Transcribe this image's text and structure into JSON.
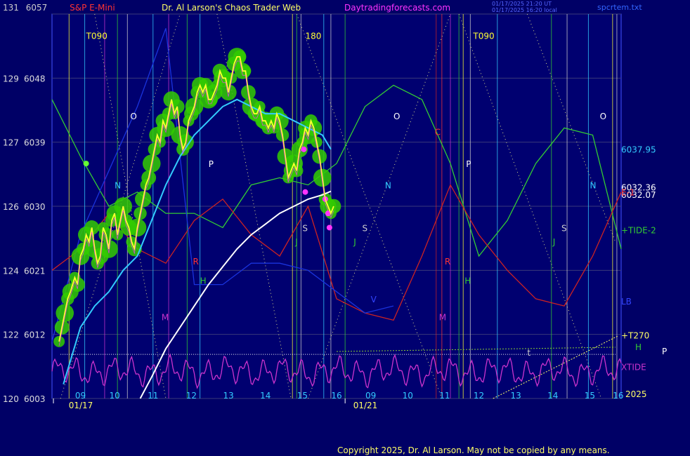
{
  "header": {
    "instrument": "S&P E-Mini",
    "author": "Dr. Al Larson's Chaos Trader Web",
    "site": "Daytradingforecasts.com",
    "stamp1": "01/17/2025 21:20 UT",
    "stamp2": "01/17/2025 16:20 local",
    "file": "spcrtem.txt"
  },
  "copyright": "Copyright 2025, Dr. Al Larson. May not be copied by any means.",
  "colors": {
    "background": "#000066",
    "grid": "#3a3a7a",
    "price": "#ffff33",
    "ma_fast": "#33ccff",
    "ma_slow": "#ffffff",
    "tide2": "#33cc33",
    "red_line": "#cc2222",
    "blue_line": "#1a33dd",
    "xtide": "#cc33cc",
    "blob": "#33cc00",
    "magenta_dot": "#ff33ff"
  },
  "chart_data": {
    "type": "line",
    "title": "S&P E-Mini",
    "y_axis": {
      "ylim": [
        6003,
        6057
      ],
      "tick_labels_price": [
        "6057",
        "6048",
        "6039",
        "6030",
        "6021",
        "6012",
        "6003"
      ],
      "tick_labels_left": [
        "131",
        "129",
        "127",
        "126",
        "124",
        "122",
        "120"
      ],
      "tick_values": [
        6057,
        6048,
        6039,
        6030,
        6021,
        6012,
        6003
      ]
    },
    "x_axis": {
      "hour_labels": [
        "09",
        "10",
        "11",
        "12",
        "13",
        "14",
        "15",
        "16",
        "09",
        "10",
        "11",
        "12",
        "13",
        "14",
        "15",
        "16"
      ],
      "date_labels": [
        "01/17",
        "01/21"
      ],
      "domain": [
        0,
        16
      ]
    },
    "right_labels": [
      {
        "text": "6037.95",
        "color": "#33ccff",
        "y": 6037.95
      },
      {
        "text": "6032.36",
        "color": "#ffffff",
        "y": 6032.6
      },
      {
        "text": "6032.07",
        "color": "#ffffff",
        "y": 6031.6
      },
      {
        "text": "E-1",
        "color": "#ff3333",
        "y": 6031.9
      },
      {
        "text": "+TIDE-2",
        "color": "#33cc33",
        "y": 6026.6
      },
      {
        "text": "LB",
        "color": "#3344ff",
        "y": 6016.6
      },
      {
        "text": "+T270",
        "color": "#ffff66",
        "y": 6011.8
      },
      {
        "text": "H",
        "color": "#33cc33",
        "y": 6010.2
      },
      {
        "text": "XTIDE",
        "color": "#cc33cc",
        "y": 6007.4
      },
      {
        "text": "P",
        "color": "#ffffff",
        "y": 6009.6
      }
    ],
    "year_label": "2025",
    "cycle_labels": [
      {
        "text": "T090",
        "x": 1.2,
        "y": 6053.5,
        "color": "#ffff33"
      },
      {
        "text": "180",
        "x": 8.9,
        "y": 6053.5,
        "color": "#ffff33"
      },
      {
        "text": "T090",
        "x": 14.8,
        "y": 6053.5,
        "color": "#ffff33"
      },
      {
        "text": "O",
        "x": 2.75,
        "y": 6042.2,
        "color": "#ffffff"
      },
      {
        "text": "O",
        "x": 12.0,
        "y": 6042.2,
        "color": "#ffffff"
      },
      {
        "text": "O",
        "x": 19.25,
        "y": 6042.2,
        "color": "#ffffff"
      },
      {
        "text": "P",
        "x": 5.5,
        "y": 6035.5,
        "color": "#ffffff"
      },
      {
        "text": "P",
        "x": 14.55,
        "y": 6035.5,
        "color": "#ffffff"
      },
      {
        "text": "N",
        "x": 2.2,
        "y": 6032.5,
        "color": "#33ccff"
      },
      {
        "text": "N",
        "x": 11.7,
        "y": 6032.5,
        "color": "#33ccff"
      },
      {
        "text": "N",
        "x": 18.9,
        "y": 6032.5,
        "color": "#33ccff"
      },
      {
        "text": "S",
        "x": 8.8,
        "y": 6026.5,
        "color": "#cccccc"
      },
      {
        "text": "S",
        "x": 10.9,
        "y": 6026.5,
        "color": "#cccccc"
      },
      {
        "text": "S",
        "x": 17.9,
        "y": 6026.5,
        "color": "#cccccc"
      },
      {
        "text": "J",
        "x": 8.55,
        "y": 6024.6,
        "color": "#33cc33"
      },
      {
        "text": "J",
        "x": 10.6,
        "y": 6024.6,
        "color": "#33cc33"
      },
      {
        "text": "J",
        "x": 17.6,
        "y": 6024.6,
        "color": "#33cc33"
      },
      {
        "text": "R",
        "x": 4.95,
        "y": 6021.8,
        "color": "#ff3333"
      },
      {
        "text": "R",
        "x": 13.8,
        "y": 6021.8,
        "color": "#ff3333"
      },
      {
        "text": "H",
        "x": 5.2,
        "y": 6019.1,
        "color": "#33cc33"
      },
      {
        "text": "H",
        "x": 14.5,
        "y": 6019.1,
        "color": "#33cc33"
      },
      {
        "text": "M",
        "x": 3.85,
        "y": 6014.0,
        "color": "#cc33cc"
      },
      {
        "text": "M",
        "x": 13.6,
        "y": 6014.0,
        "color": "#cc33cc"
      },
      {
        "text": "V",
        "x": 11.2,
        "y": 6016.5,
        "color": "#3344ff"
      },
      {
        "text": "C",
        "x": 13.45,
        "y": 6040.0,
        "color": "#ff3333"
      },
      {
        "text": "t",
        "x": 16.7,
        "y": 6009.0,
        "color": "#cccccc"
      }
    ],
    "series": [
      {
        "name": "price",
        "x": [
          0.25,
          0.35,
          0.45,
          0.55,
          0.65,
          0.8,
          0.9,
          1.0,
          1.1,
          1.2,
          1.3,
          1.4,
          1.5,
          1.6,
          1.7,
          1.8,
          1.9,
          2.0,
          2.1,
          2.2,
          2.3,
          2.4,
          2.5,
          2.6,
          2.7,
          2.8,
          2.9,
          3.0,
          3.1,
          3.2,
          3.3,
          3.4,
          3.5,
          3.6,
          3.7,
          3.8,
          3.9,
          4.0,
          4.1,
          4.2,
          4.3,
          4.4,
          4.5,
          4.6,
          4.7,
          4.8,
          4.9,
          5.0,
          5.1,
          5.2,
          5.3,
          5.4,
          5.5,
          5.6,
          5.7,
          5.8,
          5.9,
          6.0,
          6.1,
          6.2,
          6.3,
          6.4,
          6.5,
          6.6,
          6.7,
          6.8,
          6.9,
          7.0,
          7.1,
          7.2,
          7.3,
          7.4,
          7.5,
          7.6,
          7.7,
          7.8,
          7.9,
          8.0,
          8.1,
          8.2,
          8.3,
          8.4,
          8.5,
          8.6,
          8.7,
          8.8,
          8.9,
          9.0,
          9.1,
          9.2,
          9.3,
          9.4,
          9.5,
          9.6,
          9.7,
          9.8,
          9.9
        ],
        "values": [
          6011,
          6013,
          6015,
          6017,
          6018,
          6020,
          6019,
          6023,
          6024,
          6026,
          6025,
          6027,
          6024,
          6022,
          6023,
          6027,
          6026,
          6024,
          6028,
          6029,
          6026,
          6028,
          6030,
          6028,
          6027,
          6025,
          6024,
          6027,
          6029,
          6031,
          6033,
          6034,
          6036,
          6038,
          6040,
          6039,
          6042,
          6041,
          6043,
          6045,
          6043,
          6044,
          6040,
          6038,
          6039,
          6042,
          6043,
          6044,
          6046,
          6047,
          6046,
          6047,
          6045,
          6045,
          6046,
          6047,
          6049,
          6048,
          6048,
          6046,
          6048,
          6050,
          6051,
          6051,
          6049,
          6049,
          6046,
          6044,
          6043,
          6043,
          6044,
          6042,
          6042,
          6041,
          6042,
          6041,
          6043,
          6042,
          6040,
          6037,
          6034,
          6035,
          6036,
          6035,
          6038,
          6039,
          6041,
          6040,
          6042,
          6041,
          6039,
          6037,
          6034,
          6031,
          6030,
          6029,
          6030
        ],
        "color": "#ffff33"
      },
      {
        "name": "fast average",
        "x": [
          0.4,
          1.0,
          1.5,
          2.0,
          2.5,
          3.0,
          3.5,
          4.0,
          4.5,
          5.0,
          5.5,
          6.0,
          6.5,
          7.0,
          7.5,
          8.0,
          8.5,
          9.0,
          9.5,
          9.8
        ],
        "values": [
          6005,
          6013,
          6016,
          6018,
          6021,
          6023,
          6028,
          6033,
          6037,
          6040,
          6042,
          6044,
          6045,
          6044,
          6043,
          6043,
          6042,
          6041,
          6040,
          6038
        ],
        "color": "#33ccff"
      },
      {
        "name": "slow average",
        "x": [
          3.1,
          3.5,
          4.0,
          4.5,
          5.0,
          5.5,
          6.0,
          6.5,
          7.0,
          7.5,
          8.0,
          8.5,
          9.0,
          9.5,
          9.8
        ],
        "values": [
          6003,
          6006,
          6010,
          6013,
          6016,
          6019,
          6021.5,
          6024,
          6026,
          6027.5,
          6029,
          6030,
          6031,
          6031.6,
          6032.1
        ],
        "color": "#ffffff"
      },
      {
        "name": "TIDE-2",
        "x": [
          0,
          1,
          2,
          3,
          4,
          5,
          6,
          7,
          8,
          9,
          10,
          11,
          12,
          13,
          14,
          15,
          16,
          17,
          18,
          19,
          20
        ],
        "values": [
          6045,
          6037,
          6030,
          6032,
          6029,
          6029,
          6027,
          6033,
          6034,
          6033,
          6036,
          6044,
          6047,
          6045,
          6036,
          6023,
          6028,
          6036,
          6041,
          6040,
          6024
        ],
        "color": "#33cc33"
      },
      {
        "name": "red projection",
        "x": [
          0,
          1,
          2,
          3,
          4,
          5,
          6,
          7,
          8,
          9,
          10,
          11,
          12,
          13,
          14,
          15,
          16,
          17,
          18,
          19,
          20
        ],
        "values": [
          6021,
          6024,
          6029,
          6024,
          6022,
          6028,
          6031,
          6026,
          6023,
          6030,
          6017,
          6015,
          6014,
          6023,
          6033,
          6026,
          6021,
          6017,
          6016,
          6023,
          6032
        ],
        "color": "#cc2222"
      },
      {
        "name": "blue projection",
        "x": [
          0,
          1,
          2,
          3,
          4,
          5,
          6,
          7,
          8,
          9,
          10,
          11,
          12
        ],
        "values": [
          6011,
          6026,
          6035,
          6044,
          6055,
          6019,
          6019,
          6022,
          6022,
          6021,
          6018,
          6015,
          6016
        ],
        "color": "#1a33dd"
      }
    ],
    "vertical_lines": [
      {
        "x": 0.6,
        "color": "#ffff33"
      },
      {
        "x": 1.15,
        "color": "#33ccff"
      },
      {
        "x": 1.85,
        "color": "#cc33cc"
      },
      {
        "x": 2.3,
        "color": "#33cc33"
      },
      {
        "x": 2.65,
        "color": "#cccccc"
      },
      {
        "x": 3.55,
        "color": "#33ccff"
      },
      {
        "x": 4.1,
        "color": "#cc33cc"
      },
      {
        "x": 4.75,
        "color": "#33cc33"
      },
      {
        "x": 5.2,
        "color": "#33ccff"
      },
      {
        "x": 8.45,
        "color": "#ffff33"
      },
      {
        "x": 8.6,
        "color": "#33cc33"
      },
      {
        "x": 8.75,
        "color": "#cccccc"
      },
      {
        "x": 9.55,
        "color": "#33ccff"
      },
      {
        "x": 9.8,
        "color": "#cccccc"
      },
      {
        "x": 10.3,
        "color": "#33cc33"
      },
      {
        "x": 13.5,
        "color": "#cc2222"
      },
      {
        "x": 13.7,
        "color": "#ff3333"
      },
      {
        "x": 14.0,
        "color": "#cc33cc"
      },
      {
        "x": 14.3,
        "color": "#33cc33"
      },
      {
        "x": 14.45,
        "color": "#ffff33"
      },
      {
        "x": 14.7,
        "color": "#cccccc"
      },
      {
        "x": 15.65,
        "color": "#33ccff"
      },
      {
        "x": 17.55,
        "color": "#33cc33"
      },
      {
        "x": 18.1,
        "color": "#cccccc"
      },
      {
        "x": 18.85,
        "color": "#33ccff"
      },
      {
        "x": 19.7,
        "color": "#ffff33"
      },
      {
        "x": 19.85,
        "color": "#cccccc"
      }
    ]
  }
}
